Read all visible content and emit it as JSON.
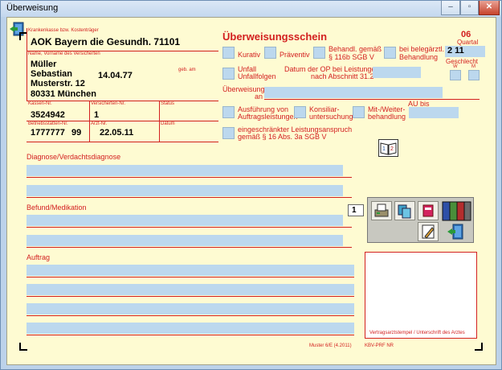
{
  "window": {
    "title": "Überweisung",
    "minimize": "–",
    "maximize": "▫",
    "close": "✕"
  },
  "form": {
    "heading": "Überweisungsschein",
    "quartal_number": "06",
    "quartal_label": "Quartal",
    "quartal_value": "2 11",
    "geschlecht_label": "Geschlecht",
    "geschlecht_w": "W",
    "geschlecht_m": "M",
    "krankenkasse_label": "Krankenkasse bzw. Kostenträger",
    "krankenkasse_value": "AOK Bayern die Gesundh.  71101",
    "name_label": "Name, Vorname des Versicherten",
    "geb_label": "geb. am",
    "name_line1": "Müller",
    "name_line2": "Sebastian",
    "birthdate": "14.04.77",
    "street": "Musterstr. 12",
    "city": "80331 München",
    "kassen_nr_label": "Kassen-Nr.",
    "kassen_nr_value": "3524942",
    "versicherten_nr_label": "Versicherten-Nr.",
    "versicherten_nr_value": "1",
    "status_label": "Status",
    "betriebsstaetten_label": "Betriebsstätten-Nr.",
    "betriebsstaetten_value": "1777777",
    "arzt_nr_label": "Arzt-Nr.",
    "arzt_nr_value": "99",
    "datum_label": "Datum",
    "datum_value": "22.05.11",
    "kurativ": "Kurativ",
    "praeventiv": "Präventiv",
    "behandl_116b_1": "Behandl. gemäß",
    "behandl_116b_2": "§ 116b SGB V",
    "beleg_1": "bei belegärztl.",
    "beleg_2": "Behandlung",
    "unfall_1": "Unfall",
    "unfall_2": "Unfallfolgen",
    "datum_op_1": "Datum der OP bei Leistungen",
    "datum_op_2": "nach Abschnitt 31.2",
    "ueberweisung_1": "Überweisung",
    "ueberweisung_2": "an",
    "au_bis": "AU bis",
    "ausfuehrung_1": "Ausführung von",
    "ausfuehrung_2": "Auftragsleistungen",
    "konsiliar_1": "Konsiliar-",
    "konsiliar_2": "untersuchung",
    "mit_weiter_1": "Mit-/Weiter-",
    "mit_weiter_2": "behandlung",
    "eingeschraenkt_1": "eingeschränkter Leistungsanspruch",
    "eingeschraenkt_2": "gemäß § 16 Abs. 3a SGB V",
    "diagnose_label": "Diagnose/Verdachtsdiagnose",
    "befund_label": "Befund/Medikation",
    "auftrag_label": "Auftrag",
    "copies_value": "1",
    "stamp_label": "Vertragsarztstempel / Unterschrift des Arztes",
    "muster_label": "Muster 6/E (4.2011)",
    "kbv_label": "KBV-PRF NR"
  },
  "icons": {
    "exit": "exit-door-icon",
    "book": "book-icon",
    "print": "printer-icon",
    "copy": "copy-pages-icon",
    "red": "red-book-icon",
    "binders": "binders-icon",
    "edit": "pencil-edit-icon",
    "close": "close-door-icon"
  }
}
